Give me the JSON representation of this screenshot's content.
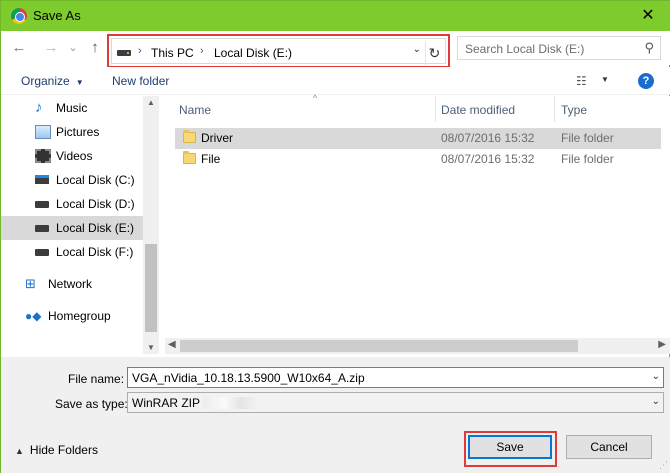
{
  "window": {
    "title": "Save As",
    "close_glyph": "✕"
  },
  "nav": {
    "back_glyph": "←",
    "forward_glyph": "→",
    "recent_glyph": "⌄",
    "up_glyph": "↑",
    "breadcrumbs": [
      "This PC",
      "Local Disk (E:)"
    ],
    "separator": "›",
    "dropdown_glyph": "⌄",
    "refresh_glyph": "↻",
    "search_placeholder": "Search Local Disk (E:)",
    "search_glyph": "⚲"
  },
  "toolbar": {
    "organize_label": "Organize",
    "caret": "▼",
    "new_folder_label": "New folder",
    "view_glyph": "☷",
    "help_glyph": "?"
  },
  "sidebar": {
    "items": [
      {
        "label": "Music",
        "icon": "music-icon"
      },
      {
        "label": "Pictures",
        "icon": "pictures-icon"
      },
      {
        "label": "Videos",
        "icon": "videos-icon"
      },
      {
        "label": "Local Disk (C:)",
        "icon": "system-drive-icon"
      },
      {
        "label": "Local Disk (D:)",
        "icon": "drive-icon"
      },
      {
        "label": "Local Disk (E:)",
        "icon": "drive-icon",
        "selected": true
      },
      {
        "label": "Local Disk (F:)",
        "icon": "drive-icon"
      },
      {
        "label": "Network",
        "icon": "network-icon"
      },
      {
        "label": "Homegroup",
        "icon": "homegroup-icon"
      }
    ],
    "scroll_up": "▲",
    "scroll_down": "▼"
  },
  "files": {
    "columns": {
      "name": "Name",
      "date": "Date modified",
      "type": "Type",
      "sort_glyph": "^"
    },
    "rows": [
      {
        "name": "Driver",
        "date": "08/07/2016 15:32",
        "type": "File folder",
        "selected": true
      },
      {
        "name": "File",
        "date": "08/07/2016 15:32",
        "type": "File folder",
        "selected": false
      }
    ],
    "scroll_left": "◀",
    "scroll_right": "▶"
  },
  "form": {
    "file_name_label": "File name:",
    "file_name_value": "VGA_nVidia_10.18.13.5900_W10x64_A.zip",
    "save_type_label": "Save as type:",
    "save_type_value": "WinRAR ZIP",
    "combo_caret": "⌄",
    "hide_folders_label": "Hide Folders",
    "hide_folders_glyph": "▲",
    "save_label": "Save",
    "cancel_label": "Cancel"
  },
  "colors": {
    "titlebar": "#7ecb2e",
    "highlight_outline": "#e03a3a",
    "default_button_border": "#0078d7",
    "selection": "#d9d9d9"
  }
}
